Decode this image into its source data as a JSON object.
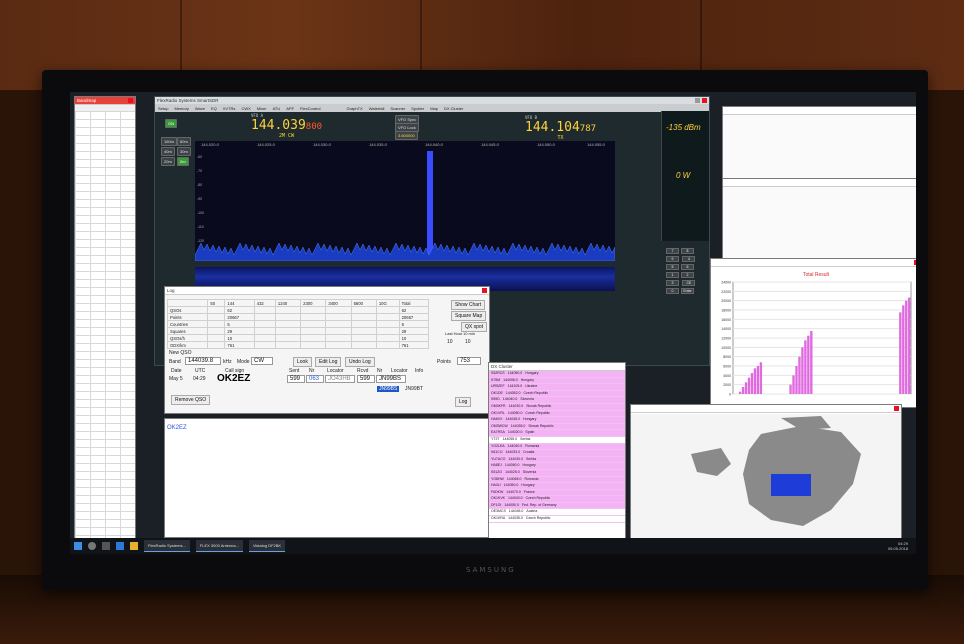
{
  "window_titles": {
    "spreadsheet": "Bandmap",
    "sdr": "FlexRadio Systems SmartSDR",
    "log": "Log",
    "chart_title": "Total Result"
  },
  "sdr": {
    "menu": [
      "Setup",
      "Memory",
      "Wave",
      "EQ",
      "XVTRs",
      "CWX",
      "Mixer",
      "ATU",
      "APF",
      "FlexControl"
    ],
    "tabs": [
      "GraphTX",
      "TX",
      "Waterfall",
      "Scanner",
      "Spotter",
      "Map",
      "DX Cluster",
      "Wave"
    ],
    "vfo_a": {
      "label": "VFO A",
      "mhz": "144.039",
      "khz": "800",
      "mode": "2M CW"
    },
    "vfo_b": {
      "label": "VFO B",
      "mhz": "144.104",
      "khz": "787",
      "mode": "TX"
    },
    "vfo_buttons": [
      "VFO Sync",
      "VFO Lock",
      "3.600000"
    ],
    "signal_dbm": "-135 dBm",
    "power": "0 W",
    "freq_ticks": [
      "144.020.0",
      "144.025.0",
      "144.030.0",
      "144.035.0",
      "144.040.0",
      "144.045.0",
      "144.050.0",
      "144.055.0"
    ],
    "db_ticks": [
      "-60",
      "-70",
      "-80",
      "-90",
      "-100",
      "-110",
      "-120",
      "-130"
    ],
    "keypad": [
      "7",
      "8",
      "9",
      "4",
      "5",
      "6",
      "1",
      "2",
      "3",
      "CE",
      "0",
      "Enter"
    ],
    "zoom_label": "ZOOM"
  },
  "log": {
    "stats_header": [
      "",
      "50",
      "144",
      "432",
      "1240",
      "2300",
      "3400",
      "5600",
      "10G",
      "Total"
    ],
    "stats_rows": [
      {
        "label": "QSOs",
        "value": "62",
        "total": "62"
      },
      {
        "label": "Points",
        "value": "20667",
        "total": "20667"
      },
      {
        "label": "Countries",
        "value": "5",
        "total": "5"
      },
      {
        "label": "Squares",
        "value": "29",
        "total": "29"
      },
      {
        "label": "QSOs/h",
        "value": "10",
        "total": "10"
      },
      {
        "label": "ODX/km",
        "value": "761",
        "total": "761"
      }
    ],
    "buttons": {
      "show_chart": "Show Chart",
      "square_map": "Square Map",
      "qx_spot": "QX spot",
      "look": "Look",
      "edit": "Edit Log",
      "undo": "Undo Log",
      "remove": "Remove QSO",
      "log": "Log"
    },
    "new_qso": "New QSO",
    "band_label": "Band",
    "band_value": "144039.8",
    "band_unit": "kHz",
    "mode_label": "Mode",
    "mode_value": "CW",
    "points_label": "Points",
    "points_value": "753",
    "last_hour": "Last Hour",
    "last_hour_value": "10",
    "last_10": "10 min",
    "last_10_value": "10",
    "date_label": "Date",
    "date_value": "May 5",
    "utc_label": "UTC",
    "utc_value": "04:29",
    "callsign_label": "Call sign",
    "callsign_value": "OK2EZ",
    "sent_label": "Sent",
    "sent_value": "599",
    "nr_label": "Nr",
    "nr_value": "063",
    "locator_label": "Locator",
    "locator_value": "JO43HB",
    "rcvd_label": "Rcvd",
    "rcvd_value": "599",
    "nr2_label": "Nr",
    "locator2_label": "Locator",
    "info_label": "Info",
    "locator_hl": "JN99BS",
    "locator_hint": "JN99BT",
    "log_entry": "OK2EZ"
  },
  "cluster": [
    {
      "call": "S52RCS",
      "freq": "144050.0",
      "country": "Hungary",
      "pink": true
    },
    {
      "call": "S75M",
      "freq": "144055.0",
      "country": "Hungary",
      "pink": true
    },
    {
      "call": "UR5ZEF",
      "freq": "144105.0",
      "country": "Ukraine",
      "pink": true
    },
    {
      "call": "OK1DE",
      "freq": "144052.0",
      "country": "Czech Republic",
      "pink": true
    },
    {
      "call": "S59D",
      "freq": "144040.0",
      "country": "Slovenia",
      "pink": true
    },
    {
      "call": "OM3KFR",
      "freq": "144030.0",
      "country": "Slovak Republic",
      "pink": true
    },
    {
      "call": "OK1VRL",
      "freq": "144050.0",
      "country": "Czech Republic",
      "pink": true
    },
    {
      "call": "HA6VX",
      "freq": "144045.0",
      "country": "Hungary",
      "pink": true
    },
    {
      "call": "OM3WCW",
      "freq": "144035.0",
      "country": "Slovak Republic",
      "pink": true
    },
    {
      "call": "EA7RSA",
      "freq": "144020.0",
      "country": "Spain",
      "pink": true
    },
    {
      "call": "YT2T",
      "freq": "144055.0",
      "country": "Serbia",
      "pink": false
    },
    {
      "call": "YO2LEA",
      "freq": "144040.0",
      "country": "Romania",
      "pink": true
    },
    {
      "call": "9A1CIJ",
      "freq": "144033.0",
      "country": "Croatia",
      "pink": true
    },
    {
      "call": "YU7ACO",
      "freq": "144030.0",
      "country": "Serbia",
      "pink": true
    },
    {
      "call": "HA8EJ",
      "freq": "144060.0",
      "country": "Hungary",
      "pink": true
    },
    {
      "call": "S51ZO",
      "freq": "144025.0",
      "country": "Slovenia",
      "pink": true
    },
    {
      "call": "YO8HW",
      "freq": "144065.0",
      "country": "Romania",
      "pink": true
    },
    {
      "call": "HA3LI",
      "freq": "144050.0",
      "country": "Hungary",
      "pink": true
    },
    {
      "call": "F6DKW",
      "freq": "144070.0",
      "country": "France",
      "pink": true
    },
    {
      "call": "OK1KVK",
      "freq": "144040.0",
      "country": "Czech Republic",
      "pink": true
    },
    {
      "call": "DF1OI",
      "freq": "144050.0",
      "country": "Fed. Rep. of Germany",
      "pink": true
    },
    {
      "call": "OE3MCS",
      "freq": "144045.0",
      "country": "Austria",
      "pink": false
    },
    {
      "call": "OK1KRA",
      "freq": "144035.0",
      "country": "Czech Republic",
      "pink": false
    }
  ],
  "chart_data": {
    "type": "bar",
    "title": "Total Result",
    "ylim": [
      0,
      24000
    ],
    "y_ticks": [
      0,
      2000,
      4000,
      6000,
      8000,
      10000,
      12000,
      14000,
      16000,
      18000,
      20000,
      22000,
      24000
    ],
    "x": [
      0,
      1,
      2,
      3,
      4,
      5,
      6,
      7,
      8,
      9,
      10,
      11,
      12,
      13,
      14,
      15,
      16,
      17,
      18,
      19,
      20,
      21,
      22,
      23,
      24,
      25,
      26,
      27,
      28,
      29,
      30,
      31,
      32,
      33,
      34,
      35,
      36,
      37,
      38,
      39,
      40,
      41,
      42,
      43,
      44,
      45,
      46,
      47,
      48,
      49,
      50,
      51,
      52,
      53,
      54,
      55,
      56,
      57,
      58,
      59
    ],
    "values": [
      0,
      0,
      500,
      1500,
      2500,
      3500,
      4500,
      5500,
      6000,
      6800,
      0,
      0,
      0,
      0,
      0,
      0,
      0,
      0,
      0,
      2000,
      4000,
      6000,
      8000,
      10000,
      11500,
      12500,
      13500,
      0,
      0,
      0,
      0,
      0,
      0,
      0,
      0,
      0,
      0,
      0,
      0,
      0,
      0,
      0,
      0,
      0,
      0,
      0,
      0,
      0,
      0,
      0,
      0,
      0,
      0,
      0,
      0,
      0,
      0,
      0,
      0,
      0
    ],
    "late_values": [
      17500,
      19000,
      20000,
      20667
    ],
    "color": "#e06be0",
    "grid": true
  },
  "taskbar": {
    "apps": [
      "FlexRadio Systems...",
      "FLEX 3000 Antenna...",
      "Vistalog DF2BK"
    ],
    "time": "04:29",
    "date": "05.05.2018"
  },
  "colors": {
    "accent": "#ffd23a",
    "spectrum_bg": "#0a0a1e",
    "waterfall": "#1a2fa0",
    "pink": "#f4b3f4"
  }
}
